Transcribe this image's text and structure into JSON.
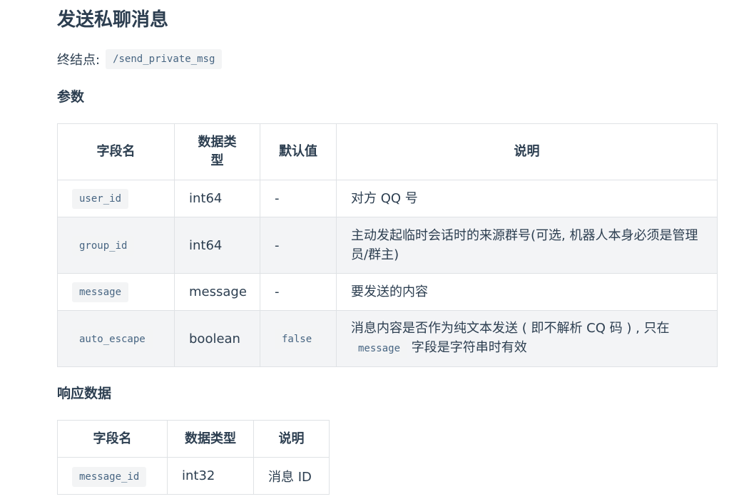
{
  "page": {
    "title": "发送私聊消息",
    "endpoint_label": "终结点:",
    "endpoint_path": "/send_private_msg"
  },
  "params": {
    "heading": "参数",
    "headers": [
      "字段名",
      "数据类型",
      "默认值",
      "说明"
    ],
    "rows": [
      {
        "field": "user_id",
        "type": "int64",
        "default": "-",
        "desc": "对方 QQ 号"
      },
      {
        "field": "group_id",
        "type": "int64",
        "default": "-",
        "desc": "主动发起临时会话时的来源群号(可选, 机器人本身必须是管理员/群主)"
      },
      {
        "field": "message",
        "type": "message",
        "default": "-",
        "desc": "要发送的内容"
      },
      {
        "field": "auto_escape",
        "type": "boolean",
        "default": "false",
        "desc_before": "消息内容是否作为纯文本发送 ( 即不解析 CQ 码 ) , 只在",
        "desc_code": "message",
        "desc_after": "字段是字符串时有效"
      }
    ]
  },
  "response": {
    "heading": "响应数据",
    "headers": [
      "字段名",
      "数据类型",
      "说明"
    ],
    "rows": [
      {
        "field": "message_id",
        "type": "int32",
        "desc": "消息 ID"
      }
    ]
  }
}
